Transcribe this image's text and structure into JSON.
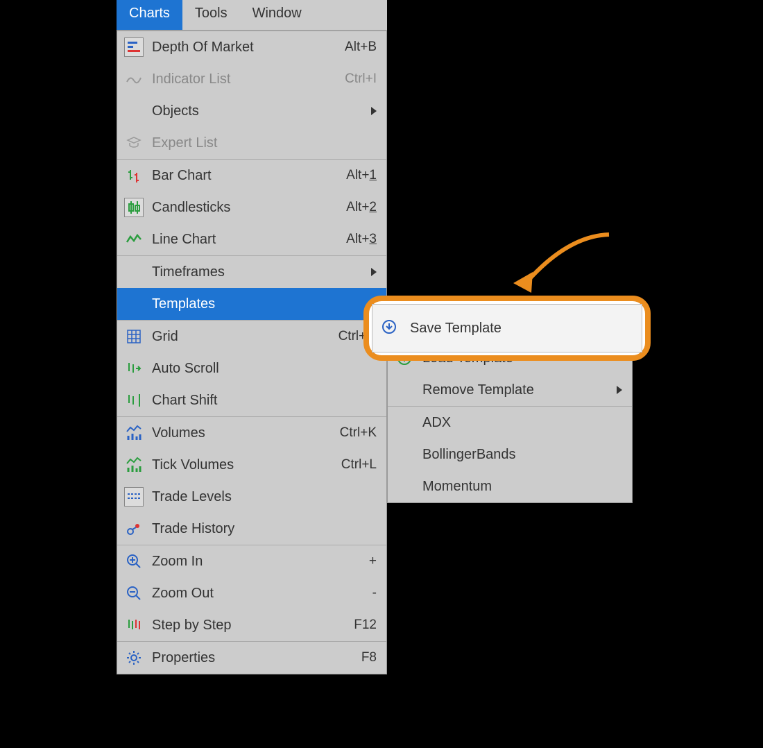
{
  "menubar": {
    "items": [
      {
        "label": "Charts",
        "active": true
      },
      {
        "label": "Tools",
        "active": false
      },
      {
        "label": "Window",
        "active": false
      }
    ]
  },
  "menu": {
    "depth_of_market": {
      "label": "Depth Of Market",
      "shortcut": "Alt+B"
    },
    "indicator_list": {
      "label": "Indicator List",
      "shortcut": "Ctrl+I"
    },
    "objects": {
      "label": "Objects"
    },
    "expert_list": {
      "label": "Expert List"
    },
    "bar_chart": {
      "label": "Bar Chart",
      "shortcut_pre": "Alt+",
      "shortcut_u": "1"
    },
    "candlesticks": {
      "label": "Candlesticks",
      "shortcut_pre": "Alt+",
      "shortcut_u": "2"
    },
    "line_chart": {
      "label": "Line Chart",
      "shortcut_pre": "Alt+",
      "shortcut_u": "3"
    },
    "timeframes": {
      "label": "Timeframes"
    },
    "templates": {
      "label": "Templates"
    },
    "grid": {
      "label": "Grid",
      "shortcut": "Ctrl+G"
    },
    "auto_scroll": {
      "label": "Auto Scroll"
    },
    "chart_shift": {
      "label": "Chart Shift"
    },
    "volumes": {
      "label": "Volumes",
      "shortcut": "Ctrl+K"
    },
    "tick_volumes": {
      "label": "Tick Volumes",
      "shortcut": "Ctrl+L"
    },
    "trade_levels": {
      "label": "Trade Levels"
    },
    "trade_history": {
      "label": "Trade History"
    },
    "zoom_in": {
      "label": "Zoom In",
      "shortcut": "+"
    },
    "zoom_out": {
      "label": "Zoom Out",
      "shortcut": "-"
    },
    "step_by_step": {
      "label": "Step by Step",
      "shortcut": "F12"
    },
    "properties": {
      "label": "Properties",
      "shortcut": "F8"
    }
  },
  "submenu": {
    "save_template": {
      "label": "Save Template"
    },
    "load_template": {
      "label": "Load Template"
    },
    "remove_template": {
      "label": "Remove Template"
    },
    "presets": [
      "ADX",
      "BollingerBands",
      "Momentum"
    ]
  }
}
